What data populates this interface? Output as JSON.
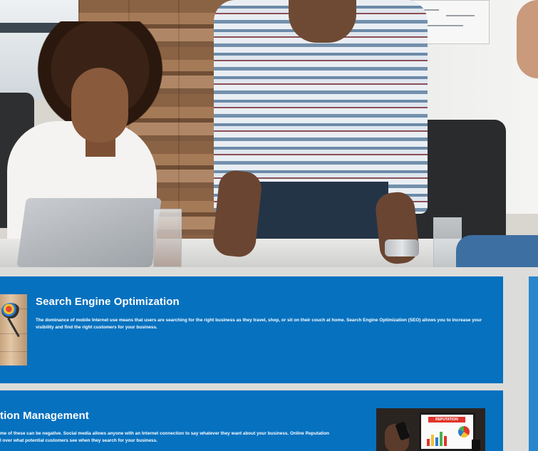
{
  "hero": {
    "image_alt": "Business team working at a laptop"
  },
  "sections": [
    {
      "title": "Search Engine Optimization",
      "body": "The dominance of mobile Internet use means that users are searching for the right business as they travel, shop, or sit on their couch at home. Search Engine Optimization (SEO) allows you to increase your visibility and find the right customers for your business.",
      "thumbnail": "desk-bowl-thumbnail"
    },
    {
      "title": "tion Management",
      "body_line1": "me of these can be negative. Social media allows anyone with an Internet connection to say whatever they want about your business. Online Reputation",
      "body_line2": "l over what potential customers see when they search for your business.",
      "thumbnail": "laptop-reputation-thumbnail",
      "thumbnail_label": "REPUTATION"
    }
  ],
  "colors": {
    "card_blue": "#0571bf",
    "side_card_blue": "#2a86cc",
    "page_background": "#dcdcda"
  }
}
